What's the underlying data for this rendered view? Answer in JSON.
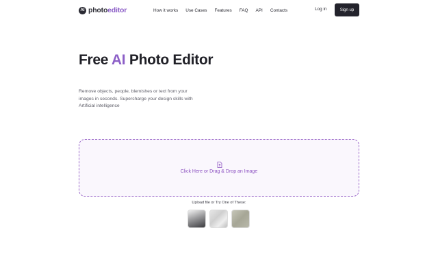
{
  "header": {
    "logo": {
      "badge": "AI",
      "brand": "photo",
      "brand_accent": "editor"
    },
    "nav": [
      "How it works",
      "Use Cases",
      "Features",
      "FAQ",
      "API",
      "Contacts"
    ],
    "login": "Log in",
    "signup": "Sign up"
  },
  "hero": {
    "title_prefix": "Free ",
    "title_accent": "AI",
    "title_suffix": " Photo Editor",
    "subtitle": "Remove objects, people, blemishes or text from your images in seconds. Supercharge your design skills with Artificial intelligence"
  },
  "upload": {
    "icon": "upload-file-icon",
    "label": "Click Here or Drag & Drop an Image",
    "try_label": "Upload file or Try One of These:"
  },
  "colors": {
    "accent": "#8c5fc7",
    "button_dark": "#23232c",
    "dropzone_border": "#9b68c9",
    "dropzone_bg": "#faf7fd"
  }
}
